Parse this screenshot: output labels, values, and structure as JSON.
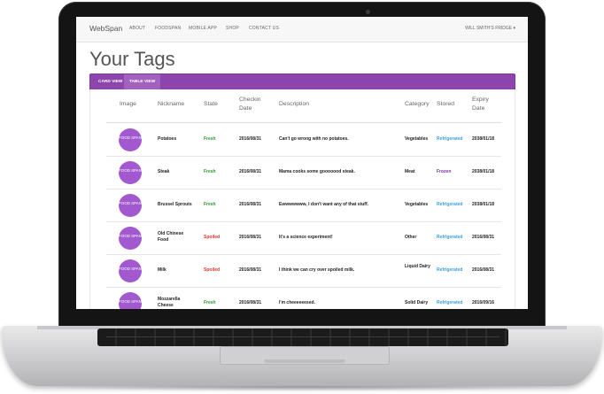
{
  "navbar": {
    "brand": "WebSpan",
    "links": [
      "ABOUT",
      "FOODSPAN",
      "MOBILE APP",
      "SHOP",
      "CONTACT US"
    ],
    "user": "WILL SMITH'S FRIDGE"
  },
  "page_title": "Your Tags",
  "tabs": [
    {
      "label": "CARD VIEW",
      "active": false
    },
    {
      "label": "TABLE VIEW",
      "active": true
    }
  ],
  "table": {
    "headers": [
      "Image",
      "Nickname",
      "State",
      "Checkin Date",
      "Description",
      "Category",
      "Stored",
      "Expiry Date"
    ],
    "logo_text": "FOOD SPAN",
    "rows": [
      {
        "nickname": "Potatoes",
        "state": "Fresh",
        "checkin": "2016/08/31",
        "description": "Can't go wrong with no potatoes.",
        "category": "Vegetables",
        "stored": "Refrigerated",
        "expiry": "2038/01/18"
      },
      {
        "nickname": "Steak",
        "state": "Fresh",
        "checkin": "2016/08/31",
        "description": "Mama cooks some gooooood steak.",
        "category": "Meat",
        "stored": "Frozen",
        "expiry": "2038/01/18"
      },
      {
        "nickname": "Brussel Sprouts",
        "state": "Fresh",
        "checkin": "2016/08/31",
        "description": "Ewwwwwww, I don't want any of that stuff.",
        "category": "Vegetables",
        "stored": "Refrigerated",
        "expiry": "2038/01/18"
      },
      {
        "nickname": "Old Chinese Food",
        "state": "Spoiled",
        "checkin": "2016/08/31",
        "description": "It's a science experiment!",
        "category": "Other",
        "stored": "Refrigerated",
        "expiry": "2016/08/31"
      },
      {
        "nickname": "Milk",
        "state": "Spoiled",
        "checkin": "2016/08/31",
        "description": "I think we can cry over spoiled milk.",
        "category": "Liquid Dairy",
        "stored": "Refrigerated",
        "expiry": "2016/08/31"
      },
      {
        "nickname": "Mozzarella Cheese",
        "state": "Fresh",
        "checkin": "2016/08/31",
        "description": "I'm cheeeeeesed.",
        "category": "Solid Dairy",
        "stored": "Refrigerated",
        "expiry": "2016/09/16"
      }
    ]
  },
  "colors": {
    "accent": "#8e44ad",
    "fresh": "#2e9a2e",
    "spoiled": "#d9342b",
    "refrigerated": "#3a9ee0",
    "frozen": "#7a2fa3"
  }
}
